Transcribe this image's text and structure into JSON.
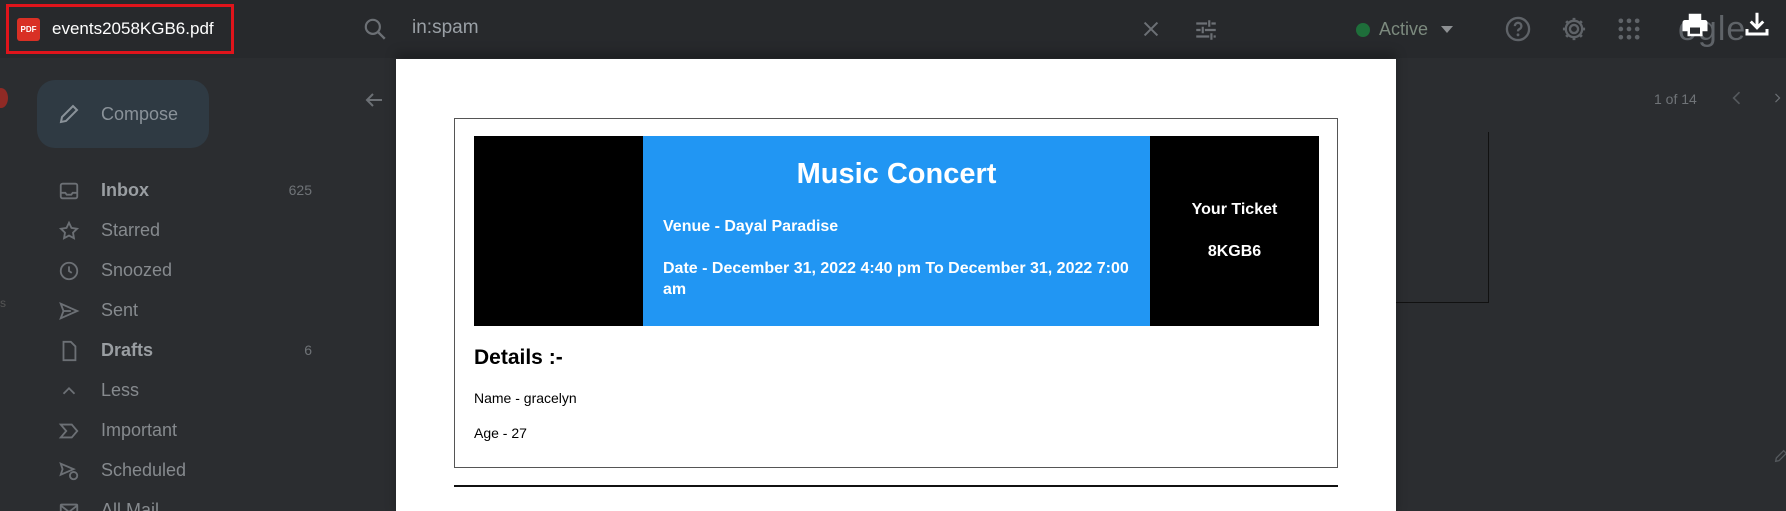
{
  "gmail": {
    "search_query": "in:spam",
    "status": "Active",
    "brand_tail": "ogle",
    "compose_label": "Compose",
    "nav": [
      {
        "label": "Inbox",
        "count": "625",
        "bold": true
      },
      {
        "label": "Starred",
        "count": ""
      },
      {
        "label": "Snoozed",
        "count": ""
      },
      {
        "label": "Sent",
        "count": ""
      },
      {
        "label": "Drafts",
        "count": "6",
        "bold": true
      },
      {
        "label": "Less",
        "count": ""
      },
      {
        "label": "Important",
        "count": ""
      },
      {
        "label": "Scheduled",
        "count": ""
      },
      {
        "label": "All Mail",
        "count": ""
      }
    ],
    "pager": "1 of 14"
  },
  "viewer": {
    "file_name": "events2058KGB6.pdf",
    "pdf_badge": "PDF"
  },
  "ticket": {
    "title": "Music Concert",
    "venue": "Venue - Dayal Paradise",
    "date": "Date - December 31, 2022 4:40 pm To December 31, 2022 7:00 am",
    "ticket_label": "Your Ticket",
    "ticket_code": "8KGB6",
    "details_heading": "Details :-",
    "name_line": "Name - gracelyn",
    "age_line": "Age - 27"
  },
  "colors": {
    "band_blue": "#2196f3",
    "highlight_red": "#e0141b",
    "pdf_icon_red": "#d93025"
  }
}
